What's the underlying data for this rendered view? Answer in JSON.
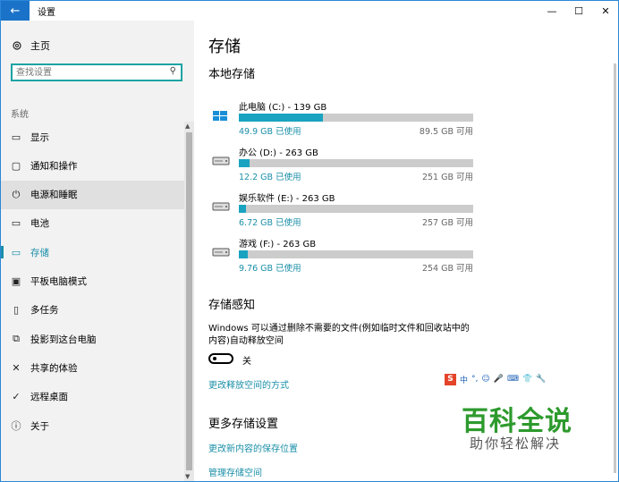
{
  "window": {
    "title": "设置",
    "back_icon": "←",
    "min_icon": "—",
    "max_icon": "☐",
    "close_icon": "✕"
  },
  "sidebar": {
    "home_label": "主页",
    "search_placeholder": "查找设置",
    "section_label": "系统",
    "items": [
      {
        "label": "显示",
        "icon": "display-icon"
      },
      {
        "label": "通知和操作",
        "icon": "notification-icon"
      },
      {
        "label": "电源和睡眠",
        "icon": "power-icon"
      },
      {
        "label": "电池",
        "icon": "battery-icon"
      },
      {
        "label": "存储",
        "icon": "storage-icon"
      },
      {
        "label": "平板电脑模式",
        "icon": "tablet-icon"
      },
      {
        "label": "多任务",
        "icon": "multitask-icon"
      },
      {
        "label": "投影到这台电脑",
        "icon": "project-icon"
      },
      {
        "label": "共享的体验",
        "icon": "shared-icon"
      },
      {
        "label": "远程桌面",
        "icon": "remote-icon"
      },
      {
        "label": "关于",
        "icon": "info-icon"
      }
    ],
    "active_item": "存储",
    "hover_item": "电源和睡眠"
  },
  "main": {
    "page_title": "存储",
    "local_storage_title": "本地存储",
    "drives": [
      {
        "name": "此电脑 (C:) - 139 GB",
        "used": "49.9 GB 已使用",
        "free": "89.5 GB 可用",
        "used_fraction": 0.36,
        "icon": "windows-drive-icon"
      },
      {
        "name": "办公 (D:) - 263 GB",
        "used": "12.2 GB 已使用",
        "free": "251 GB 可用",
        "used_fraction": 0.046,
        "icon": "drive-icon"
      },
      {
        "name": "娱乐软件 (E:) - 263 GB",
        "used": "6.72 GB 已使用",
        "free": "257 GB 可用",
        "used_fraction": 0.026,
        "icon": "drive-icon"
      },
      {
        "name": "游戏 (F:) - 263 GB",
        "used": "9.76 GB 已使用",
        "free": "254 GB 可用",
        "used_fraction": 0.037,
        "icon": "drive-icon"
      }
    ],
    "sense_title": "存储感知",
    "sense_desc": "Windows 可以通过删除不需要的文件(例如临时文件和回收站中的内容)自动释放空间",
    "toggle_label": "关",
    "toggle_on": false,
    "change_link": "更改释放空间的方式",
    "more_title": "更多存储设置",
    "link_save_location": "更改新内容的保存位置",
    "link_manage": "管理存储空间"
  },
  "overlay": {
    "ime_logo": "S",
    "ime_items": [
      "中",
      "°,",
      "☺",
      "🎤",
      "⌨",
      "👕",
      "🔧"
    ],
    "watermark_title": "百科全说",
    "watermark_sub": "助你轻松解决"
  },
  "colors": {
    "accent": "#1a8fa8",
    "bar_fill": "#1aa3c1",
    "bar_track": "#cccccc",
    "sidebar_bg": "#f2f2f2"
  }
}
